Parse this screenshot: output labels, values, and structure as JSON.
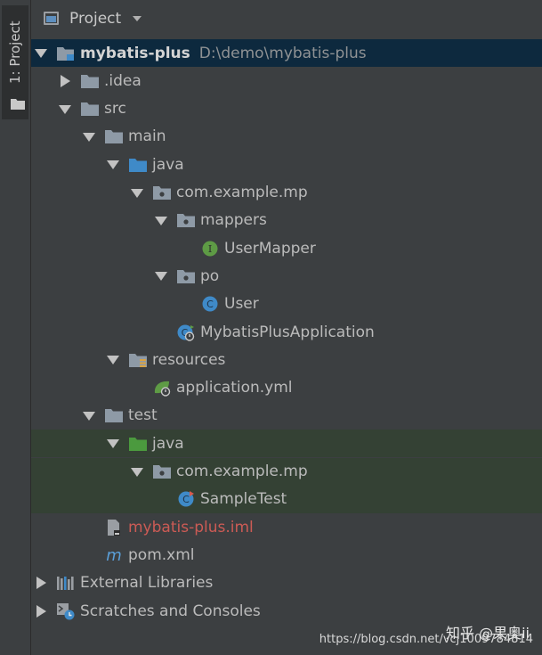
{
  "sidebar": {
    "tab_label": "1: Project"
  },
  "header": {
    "title": "Project"
  },
  "tree": [
    {
      "label": "mybatis-plus",
      "path": "D:\\demo\\mybatis-plus",
      "icon": "module-folder-icon",
      "arrow": "down",
      "style": "bold",
      "bg": "sel"
    },
    {
      "label": ".idea",
      "icon": "folder-icon",
      "arrow": "right"
    },
    {
      "label": "src",
      "icon": "folder-icon",
      "arrow": "down"
    },
    {
      "label": "main",
      "icon": "folder-icon",
      "arrow": "down"
    },
    {
      "label": "java",
      "icon": "source-folder-icon",
      "arrow": "down"
    },
    {
      "label": "com.example.mp",
      "icon": "package-icon",
      "arrow": "down"
    },
    {
      "label": "mappers",
      "icon": "package-icon",
      "arrow": "down"
    },
    {
      "label": "UserMapper",
      "icon": "interface-icon",
      "arrow": ""
    },
    {
      "label": "po",
      "icon": "package-icon",
      "arrow": "down"
    },
    {
      "label": "User",
      "icon": "class-icon",
      "arrow": ""
    },
    {
      "label": "MybatisPlusApplication",
      "icon": "spring-class-icon",
      "arrow": ""
    },
    {
      "label": "resources",
      "icon": "resources-folder-icon",
      "arrow": "down"
    },
    {
      "label": "application.yml",
      "icon": "spring-config-icon",
      "arrow": ""
    },
    {
      "label": "test",
      "icon": "folder-icon",
      "arrow": "down"
    },
    {
      "label": "java",
      "icon": "test-source-folder-icon",
      "arrow": "down",
      "bg": "test"
    },
    {
      "label": "com.example.mp",
      "icon": "package-icon",
      "arrow": "down",
      "bg": "test"
    },
    {
      "label": "SampleTest",
      "icon": "test-class-icon",
      "arrow": "",
      "bg": "test"
    },
    {
      "label": "mybatis-plus.iml",
      "icon": "iml-file-icon",
      "arrow": "",
      "style": "red"
    },
    {
      "label": "pom.xml",
      "icon": "maven-icon",
      "arrow": ""
    },
    {
      "label": "External Libraries",
      "icon": "libraries-icon",
      "arrow": "right"
    },
    {
      "label": "Scratches and Consoles",
      "icon": "scratches-icon",
      "arrow": "right"
    }
  ],
  "watermark": {
    "cn": "知乎 @果奥ii",
    "url": "https://blog.csdn.net/vcj1009784814"
  },
  "colors": {
    "background": "#3c3f41",
    "selected_row": "#0d293e",
    "test_row": "#344134",
    "folder": "#8e9aa6",
    "source_folder": "#3f8ac8",
    "test_source_folder": "#4b9a3e",
    "iml_text": "#cc5b55"
  }
}
